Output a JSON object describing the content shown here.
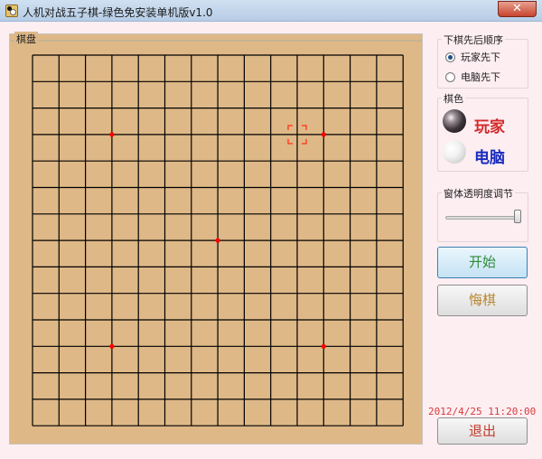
{
  "window": {
    "title": "人机对战五子棋-绿色免安装单机版v1.0",
    "close_glyph": "✕"
  },
  "board": {
    "label": "棋盘",
    "lines": 15,
    "star_points": [
      [
        3,
        3
      ],
      [
        3,
        11
      ],
      [
        7,
        7
      ],
      [
        11,
        3
      ],
      [
        11,
        11
      ]
    ],
    "cursor": {
      "row": 3,
      "col": 10
    },
    "colors": {
      "wood": "#deb887",
      "grid": "#000000",
      "star": "#ff0000",
      "cursor": "#ff3b1f"
    }
  },
  "order": {
    "label": "下棋先后顺序",
    "options": [
      {
        "label": "玩家先下",
        "checked": true
      },
      {
        "label": "电脑先下",
        "checked": false
      }
    ]
  },
  "stone_color": {
    "label": "棋色",
    "player": {
      "label": "玩家",
      "stone": "black",
      "color": "#d32b2b"
    },
    "computer": {
      "label": "电脑",
      "stone": "white",
      "color": "#1a2bbf"
    }
  },
  "opacity": {
    "label": "窗体透明度调节",
    "value": 1.0
  },
  "buttons": {
    "start": "开始",
    "undo": "悔棋",
    "exit": "退出"
  },
  "datetime": "2012/4/25 11:20:00"
}
